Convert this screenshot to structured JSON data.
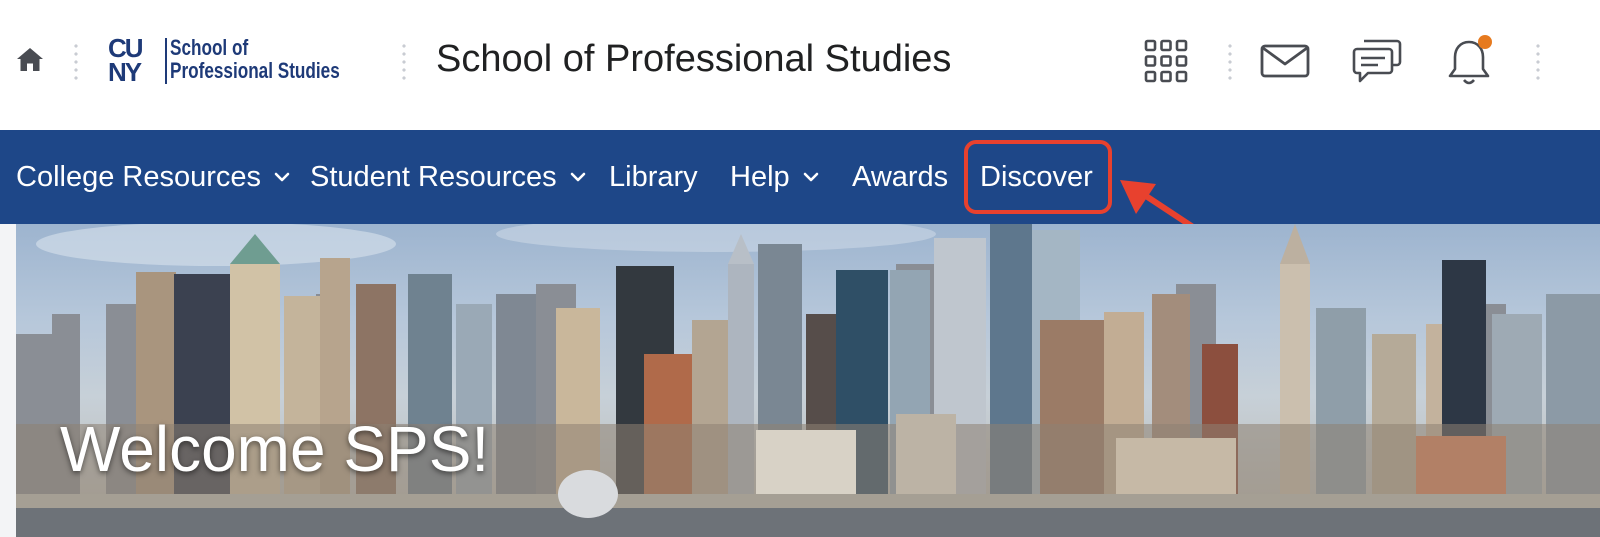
{
  "header": {
    "logo": {
      "abbrev_top": "CU",
      "abbrev_bottom": "NY",
      "line1": "School of",
      "line2": "Professional Studies"
    },
    "title": "School of Professional Studies",
    "icons": [
      "home-icon",
      "waffle-grid-icon",
      "mail-icon",
      "chat-icon",
      "bell-icon"
    ],
    "notification_badge_color": "#e67a1f"
  },
  "nav": {
    "items": [
      {
        "label": "College Resources",
        "has_dropdown": true
      },
      {
        "label": "Student Resources",
        "has_dropdown": true
      },
      {
        "label": "Library",
        "has_dropdown": false
      },
      {
        "label": "Help",
        "has_dropdown": true
      },
      {
        "label": "Awards",
        "has_dropdown": false
      },
      {
        "label": "Discover",
        "has_dropdown": false
      }
    ],
    "highlighted_item": "Discover",
    "background_color": "#1e4788",
    "annotation_color": "#e8412e"
  },
  "banner": {
    "welcome_text": "Welcome SPS!"
  }
}
